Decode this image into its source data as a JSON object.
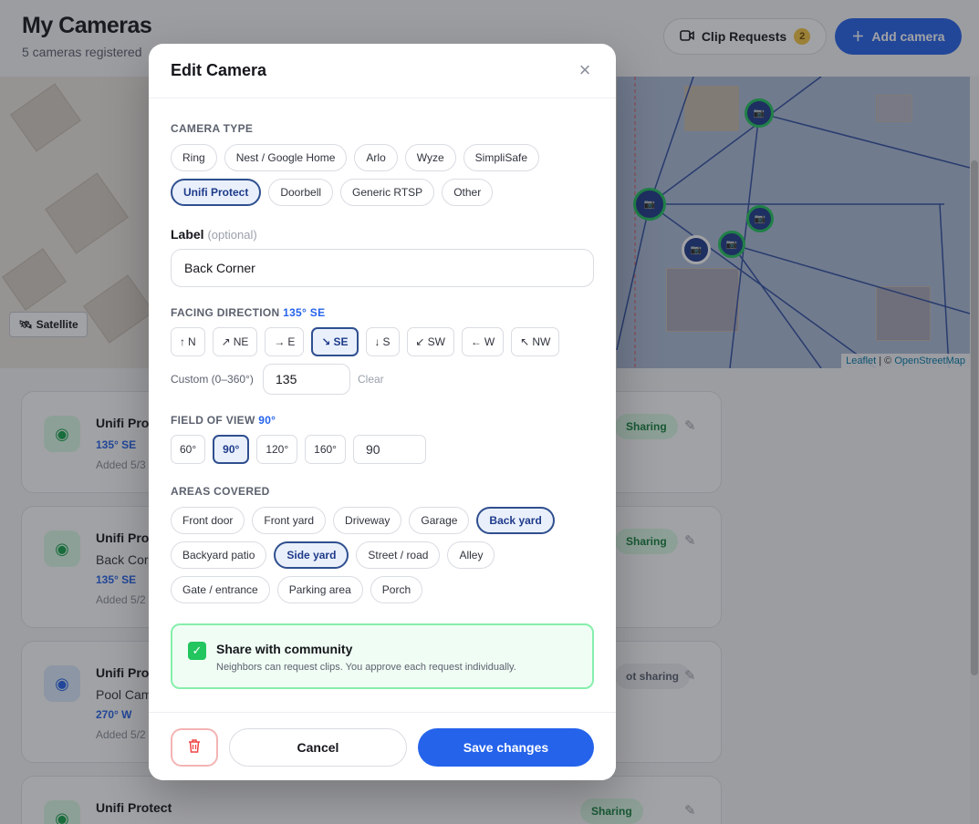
{
  "page": {
    "title": "My Cameras",
    "subtitle": "5 cameras registered",
    "clip_requests_label": "Clip Requests",
    "clip_requests_count": "2",
    "add_camera_label": "Add camera"
  },
  "map": {
    "satellite_label": "Satellite",
    "attribution_leaflet": "Leaflet",
    "attribution_sep": " | © ",
    "attribution_osm": "OpenStreetMap"
  },
  "camera_list": [
    {
      "name": "Unifi Prot",
      "label": "",
      "direction": "135° SE",
      "added": "Added 5/3",
      "sharing": "Sharing"
    },
    {
      "name": "Unifi Prot",
      "label": "Back Cor",
      "direction": "135° SE",
      "added": "Added 5/2",
      "sharing": "Sharing"
    },
    {
      "name": "Unifi Prot",
      "label": "Pool Cam",
      "direction": "270° W",
      "added": "Added 5/2",
      "sharing": "ot sharing"
    },
    {
      "name": "Unifi Protect",
      "label": "",
      "direction": "",
      "added": "",
      "sharing": "Sharing"
    }
  ],
  "modal": {
    "title": "Edit Camera",
    "camera_type": {
      "label": "CAMERA TYPE",
      "row1": [
        "Ring",
        "Nest / Google Home",
        "Arlo",
        "Wyze",
        "SimpliSafe"
      ],
      "row2": [
        "Unifi Protect",
        "Doorbell",
        "Generic RTSP",
        "Other"
      ],
      "selected": "Unifi Protect"
    },
    "label_field": {
      "title": "Label",
      "hint": "(optional)",
      "value": "Back Corner"
    },
    "facing": {
      "label": "FACING DIRECTION",
      "value_text": "135° SE",
      "directions": [
        {
          "arrow": "↑",
          "label": "N"
        },
        {
          "arrow": "↗",
          "label": "NE"
        },
        {
          "arrow": "→",
          "label": "E"
        },
        {
          "arrow": "↘",
          "label": "SE"
        },
        {
          "arrow": "↓",
          "label": "S"
        },
        {
          "arrow": "↙",
          "label": "SW"
        },
        {
          "arrow": "←",
          "label": "W"
        },
        {
          "arrow": "↖",
          "label": "NW"
        }
      ],
      "selected": "SE",
      "custom_label": "Custom (0–360°)",
      "custom_value": "135",
      "clear_label": "Clear"
    },
    "fov": {
      "label": "FIELD OF VIEW",
      "value_text": "90°",
      "options": [
        "60°",
        "90°",
        "120°",
        "160°"
      ],
      "selected": "90°",
      "custom_value": "90"
    },
    "areas": {
      "label": "AREAS COVERED",
      "row1": [
        "Front door",
        "Front yard",
        "Driveway",
        "Garage",
        "Back yard"
      ],
      "row2": [
        "Backyard patio",
        "Side yard",
        "Street / road",
        "Alley"
      ],
      "row3": [
        "Gate / entrance",
        "Parking area",
        "Porch"
      ],
      "selected": [
        "Back yard",
        "Side yard"
      ]
    },
    "share": {
      "checked": true,
      "title": "Share with community",
      "description": "Neighbors can request clips. You approve each request individually."
    },
    "footer": {
      "cancel_label": "Cancel",
      "save_label": "Save changes"
    }
  },
  "colors": {
    "accent": "#2563eb",
    "selected_border": "#2f4f8f",
    "share_green": "#22c55e",
    "delete_red": "#ef4444"
  }
}
